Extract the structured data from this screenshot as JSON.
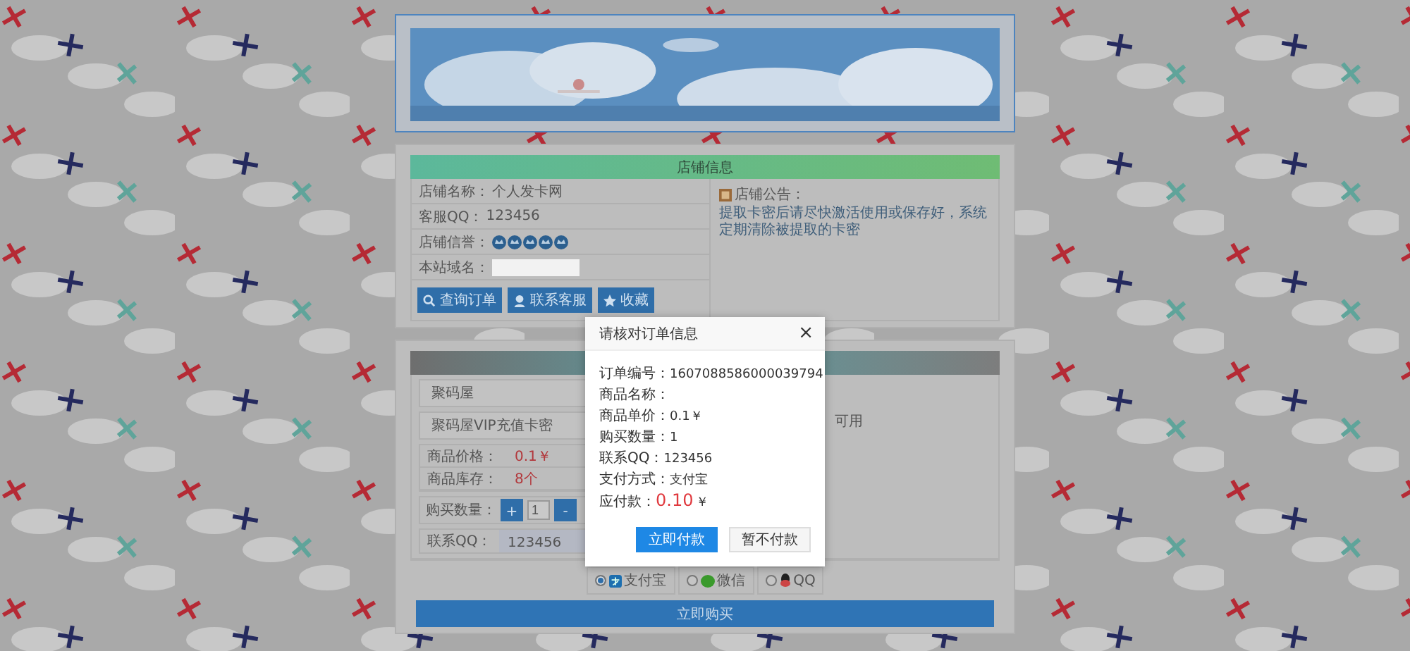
{
  "store_info": {
    "title": "店铺信息",
    "rows": [
      {
        "kind": "text",
        "label": "店铺名称：",
        "value": "个人发卡网"
      },
      {
        "kind": "text",
        "label": "客服QQ：",
        "value": "123456"
      },
      {
        "kind": "stars",
        "label": "店铺信誉：",
        "stars": 5
      },
      {
        "kind": "redacted",
        "label": "本站域名："
      }
    ],
    "buttons": [
      {
        "kind": "search",
        "label": "查询订单"
      },
      {
        "kind": "user",
        "label": "联系客服"
      },
      {
        "kind": "star",
        "label": "收藏"
      }
    ],
    "notice": {
      "title": "店铺公告：",
      "text": "提取卡密后请尽快激活使用或保存好，系统定期清除被提取的卡密"
    }
  },
  "product": {
    "category": "聚码屋",
    "item": "聚码屋VIP充值卡密",
    "price_label": "商品价格：",
    "price": "0.1￥",
    "stock_label": "商品库存：",
    "stock": "8个",
    "quantity_label": "购买数量：",
    "plus": "+",
    "quantity": "1",
    "minus": "-",
    "contact_label": "联系QQ：",
    "contact": "123456",
    "note": "可用"
  },
  "payments": [
    {
      "kind": "alipay",
      "label": "支付宝",
      "selected": true
    },
    {
      "kind": "wechat",
      "label": "微信",
      "selected": false
    },
    {
      "kind": "qq",
      "label": "QQ",
      "selected": false
    }
  ],
  "buy_button": "立即购买",
  "modal": {
    "title": "请核对订单信息",
    "close": "×",
    "lines": [
      {
        "kind": "text",
        "label": "订单编号：",
        "value": "1607088586000039794"
      },
      {
        "kind": "blank",
        "label": "商品名称："
      },
      {
        "kind": "text",
        "label": "商品单价：",
        "value": "0.1￥"
      },
      {
        "kind": "text",
        "label": "购买数量：",
        "value": "1"
      },
      {
        "kind": "text",
        "label": "联系QQ：",
        "value": "123456"
      },
      {
        "kind": "text",
        "label": "支付方式：",
        "value": "支付宝"
      },
      {
        "kind": "amount",
        "label": "应付款：",
        "value": "0.10",
        "unit": "￥"
      }
    ],
    "buttons": [
      {
        "kind": "primary",
        "label": "立即付款"
      },
      {
        "kind": "default",
        "label": "暂不付款"
      }
    ]
  }
}
